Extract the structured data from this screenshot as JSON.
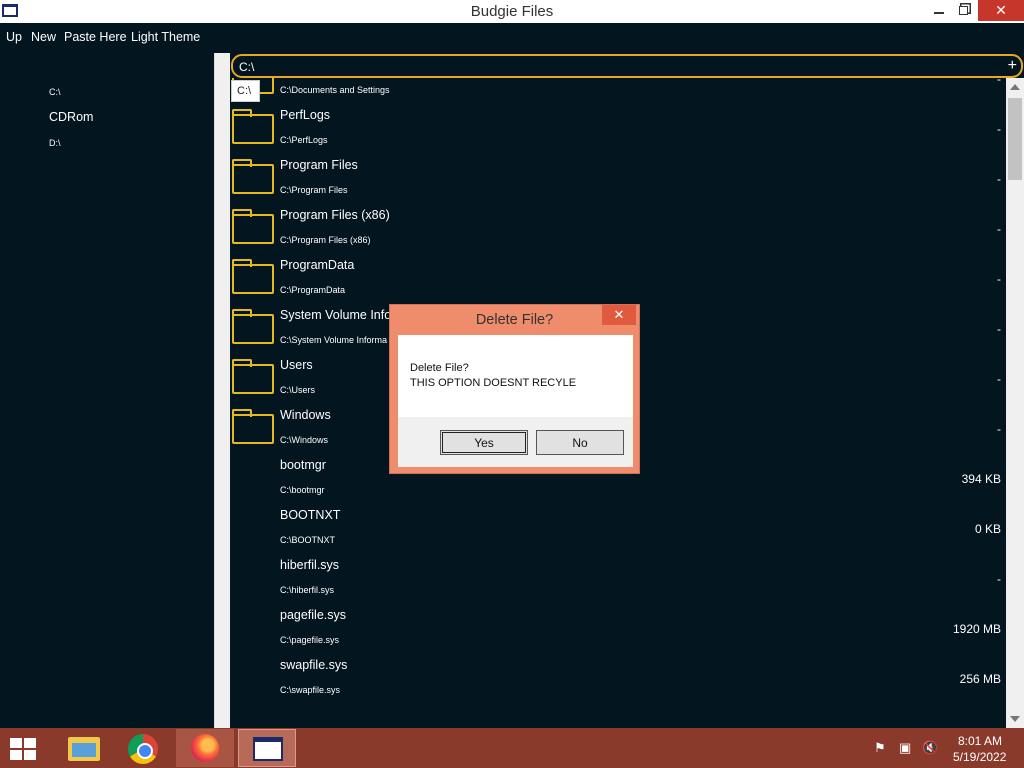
{
  "window": {
    "title": "Budgie Files"
  },
  "menu": [
    "Up",
    "New",
    "Paste Here",
    "Light Theme"
  ],
  "sidebar": {
    "drives": [
      "C:\\",
      "CDRom",
      "D:\\"
    ]
  },
  "pathbar": {
    "value": "C:\\",
    "add_label": "+",
    "tooltip": "C:\\"
  },
  "files": [
    {
      "name": "",
      "path": "C:\\Documents and Settings",
      "size": "-",
      "folder": true
    },
    {
      "name": "PerfLogs",
      "path": "C:\\PerfLogs",
      "size": "-",
      "folder": true
    },
    {
      "name": "Program Files",
      "path": "C:\\Program Files",
      "size": "-",
      "folder": true
    },
    {
      "name": "Program Files (x86)",
      "path": "C:\\Program Files (x86)",
      "size": "-",
      "folder": true
    },
    {
      "name": "ProgramData",
      "path": "C:\\ProgramData",
      "size": "-",
      "folder": true
    },
    {
      "name": "System Volume Infor",
      "path": "C:\\System Volume Informa",
      "size": "-",
      "folder": true
    },
    {
      "name": "Users",
      "path": "C:\\Users",
      "size": "-",
      "folder": true
    },
    {
      "name": "Windows",
      "path": "C:\\Windows",
      "size": "-",
      "folder": true
    },
    {
      "name": "bootmgr",
      "path": "C:\\bootmgr",
      "size": "394 KB",
      "folder": false
    },
    {
      "name": "BOOTNXT",
      "path": "C:\\BOOTNXT",
      "size": "0 KB",
      "folder": false
    },
    {
      "name": "hiberfil.sys",
      "path": "C:\\hiberfil.sys",
      "size": "-",
      "folder": false
    },
    {
      "name": "pagefile.sys",
      "path": "C:\\pagefile.sys",
      "size": "1920 MB",
      "folder": false
    },
    {
      "name": "swapfile.sys",
      "path": "C:\\swapfile.sys",
      "size": "256 MB",
      "folder": false
    }
  ],
  "dialog": {
    "title": "Delete File?",
    "close": "✕",
    "message_line1": "Delete File?",
    "message_line2": "THIS OPTION DOESNT RECYLE",
    "yes_label": "Yes",
    "no_label": "No"
  },
  "taskbar": {
    "time": "8:01 AM",
    "date": "5/19/2022"
  },
  "colors": {
    "background": "#03151f",
    "accent": "#e6a722",
    "dialog": "#ee8c6b",
    "taskbar": "#8a3a2b"
  }
}
